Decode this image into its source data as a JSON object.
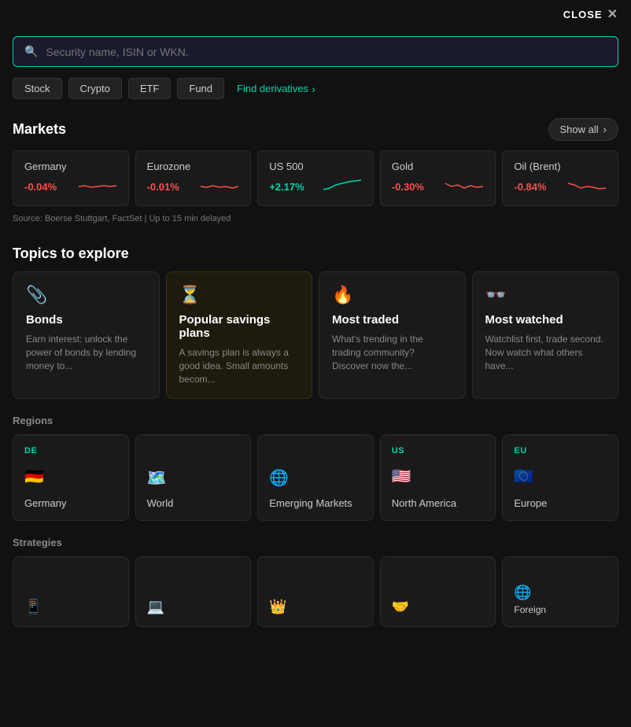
{
  "header": {
    "close_label": "CLOSE"
  },
  "search": {
    "placeholder": "Security name, ISIN or WKN."
  },
  "filters": {
    "pills": [
      "Stock",
      "Crypto",
      "ETF",
      "Fund"
    ],
    "find_derivatives": "Find derivatives"
  },
  "markets": {
    "title": "Markets",
    "show_all": "Show all",
    "source": "Source: Boerse Stuttgart, FactSet | Up to 15 min delayed",
    "items": [
      {
        "name": "Germany",
        "change": "-0.04%",
        "positive": false
      },
      {
        "name": "Eurozone",
        "change": "-0.01%",
        "positive": false
      },
      {
        "name": "US 500",
        "change": "+2.17%",
        "positive": true
      },
      {
        "name": "Gold",
        "change": "-0.30%",
        "positive": false
      },
      {
        "name": "Oil (Brent)",
        "change": "-0.84%",
        "positive": false
      }
    ]
  },
  "topics": {
    "title": "Topics to explore",
    "items": [
      {
        "emoji": "📎",
        "title": "Bonds",
        "desc": "Earn interest: unlock the power of bonds by lending money to...",
        "card_type": "normal"
      },
      {
        "emoji": "⏳",
        "title": "Popular savings plans",
        "desc": "A savings plan is always a good idea. Small amounts becom...",
        "card_type": "highlight2"
      },
      {
        "emoji": "🔥",
        "title": "Most traded",
        "desc": "What's trending in the trading community? Discover now the...",
        "card_type": "normal"
      },
      {
        "emoji": "👓",
        "title": "Most watched",
        "desc": "Watchlist first, trade second. Now watch what others have...",
        "card_type": "normal"
      }
    ]
  },
  "regions": {
    "title": "Regions",
    "items": [
      {
        "tag": "DE",
        "icon": "🇩🇪",
        "name": "Germany"
      },
      {
        "tag": "",
        "icon": "🗺️",
        "name": "World"
      },
      {
        "tag": "",
        "icon": "🌐",
        "name": "Emerging Markets"
      },
      {
        "tag": "US",
        "icon": "🇺🇸",
        "name": "North America"
      },
      {
        "tag": "EU",
        "icon": "🇪🇺",
        "name": "Europe"
      }
    ]
  },
  "strategies": {
    "title": "Strategies",
    "items": [
      {
        "icon": "📱",
        "name": ""
      },
      {
        "icon": "💻",
        "name": ""
      },
      {
        "icon": "👑",
        "name": ""
      },
      {
        "icon": "🤝",
        "name": ""
      },
      {
        "icon": "🌐",
        "name": "Foreign"
      }
    ]
  }
}
